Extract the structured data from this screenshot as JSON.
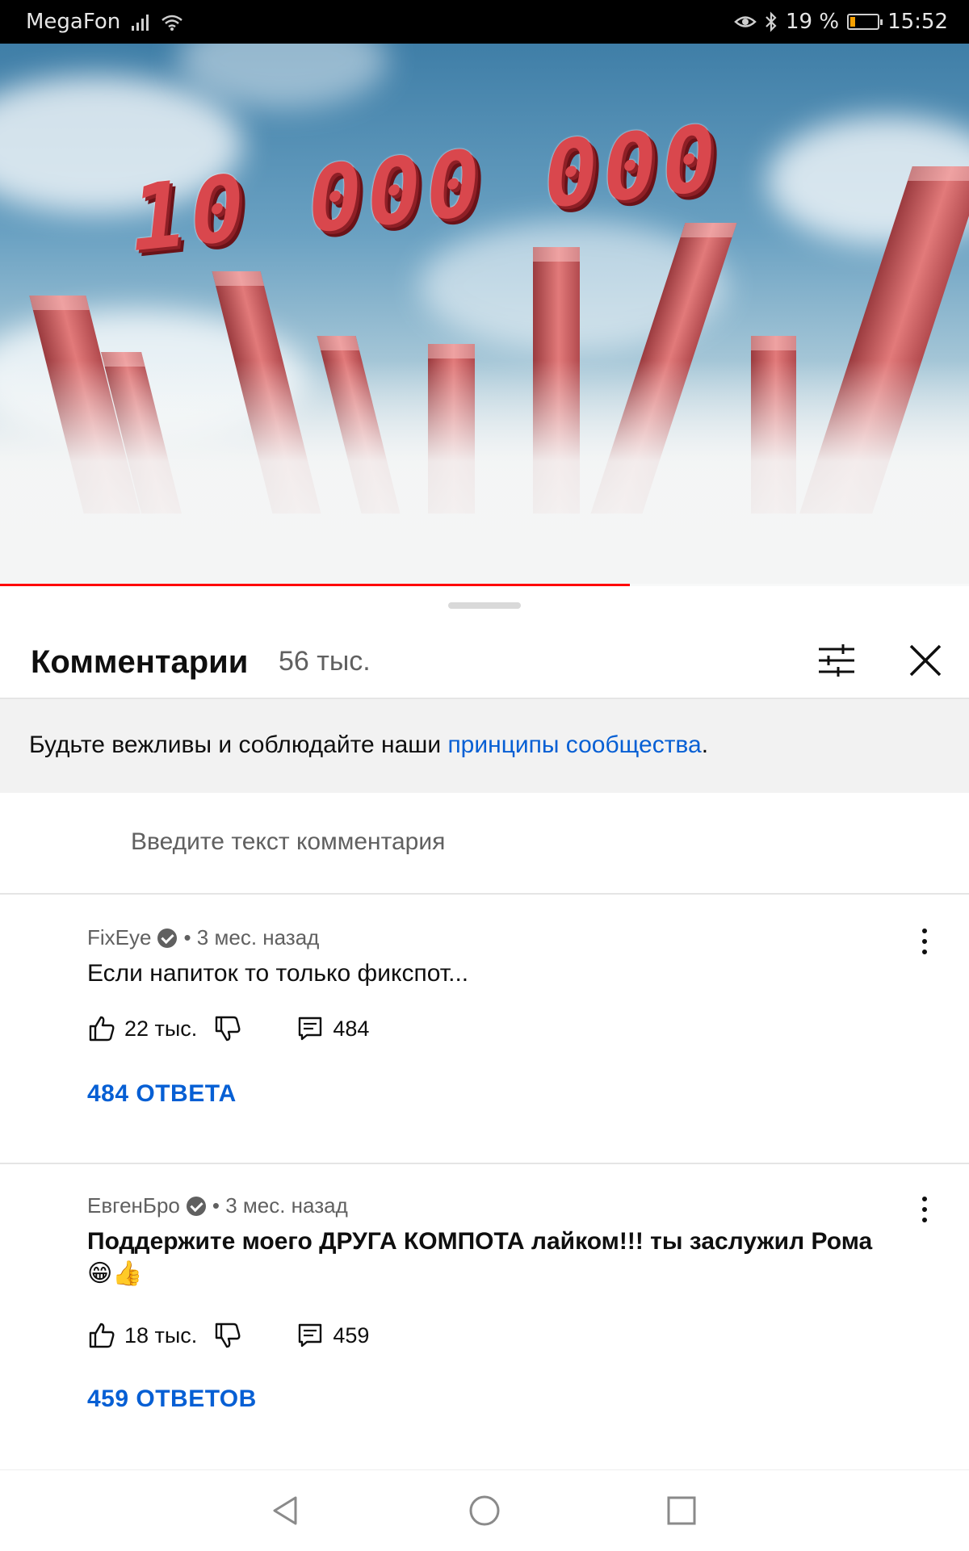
{
  "status_bar": {
    "carrier": "MegaFon",
    "battery_percent": "19 %",
    "battery_level": 0.19,
    "time": "15:52",
    "icons": [
      "signal-icon",
      "wifi-icon",
      "eye-comfort-icon",
      "bluetooth-icon",
      "battery-icon"
    ]
  },
  "video": {
    "overlay_text": "10 000 000",
    "progress": 0.65,
    "progress_color": "#ff0000"
  },
  "comments_panel": {
    "title": "Комментарии",
    "count": "56 тыс.",
    "guidelines_prefix": "Будьте вежливы и соблюдайте наши ",
    "guidelines_link": "принципы сообщества",
    "guidelines_suffix": ".",
    "input_placeholder": "Введите текст комментария",
    "link_color": "#065fd4"
  },
  "comments": [
    {
      "author": "FixEye",
      "verified": true,
      "time": "• 3 мес. назад",
      "text": "Если напиток то только фикспот...",
      "likes": "22 тыс.",
      "reply_count": "484",
      "replies_label": "484 ОТВЕТА"
    },
    {
      "author": "ЕвгенБро",
      "verified": true,
      "time": "• 3 мес. назад",
      "text": "Поддержите моего ДРУГА КОМПОТА лайком!!! ты заслужил Рома",
      "emojis": "😁👍",
      "likes": "18 тыс.",
      "reply_count": "459",
      "replies_label": "459 ОТВЕТОВ"
    }
  ],
  "nav": {
    "icons": [
      "back-icon",
      "home-icon",
      "recents-icon"
    ]
  }
}
